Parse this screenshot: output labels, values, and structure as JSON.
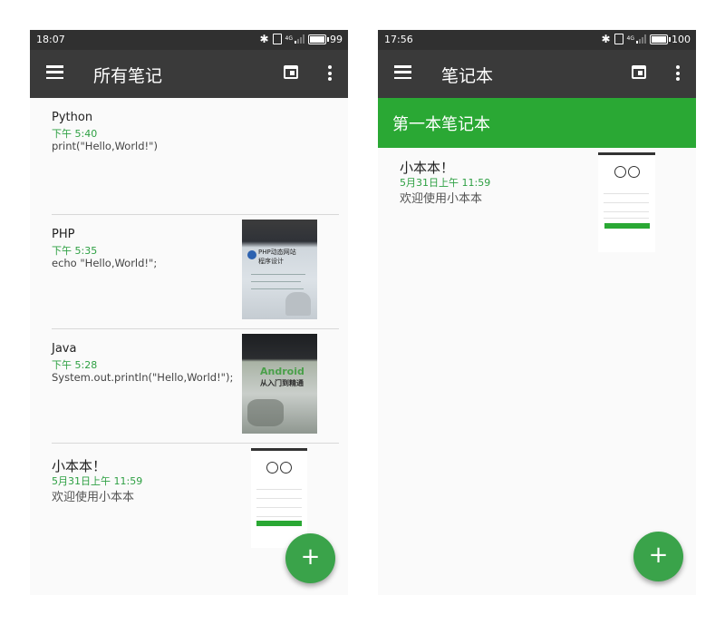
{
  "left": {
    "status": {
      "time": "18:07",
      "network": "4G",
      "battery": "99"
    },
    "appbar": {
      "title": "所有笔记"
    },
    "notes": [
      {
        "title": "Python",
        "time": "下午 5:40",
        "content": "print(\"Hello,World!\")"
      },
      {
        "title": "PHP",
        "time": "下午 5:35",
        "content": "echo \"Hello,World!\";",
        "image_text": [
          "PHP动态网站",
          "程序设计"
        ]
      },
      {
        "title": "Java",
        "time": "下午 5:28",
        "content": "System.out.println(\"Hello,World!\");",
        "image_text": [
          "Android",
          "从入门到精通"
        ]
      },
      {
        "title": "小本本！",
        "time": "5月31日上午 11:59",
        "content": "欢迎使用小本本"
      }
    ],
    "fab": "+"
  },
  "right": {
    "status": {
      "time": "17:56",
      "network": "4G",
      "battery": "100"
    },
    "appbar": {
      "title": "笔记本"
    },
    "notebook_title": "第一本笔记本",
    "notes": [
      {
        "title": "小本本！",
        "time": "5月31日上午 11:59",
        "content": "欢迎使用小本本"
      }
    ],
    "fab": "+"
  },
  "colors": {
    "appbar": "#3a3a3a",
    "status": "#303030",
    "accent": "#2aa834",
    "fab": "#3aa34a",
    "date": "#2ea043"
  }
}
